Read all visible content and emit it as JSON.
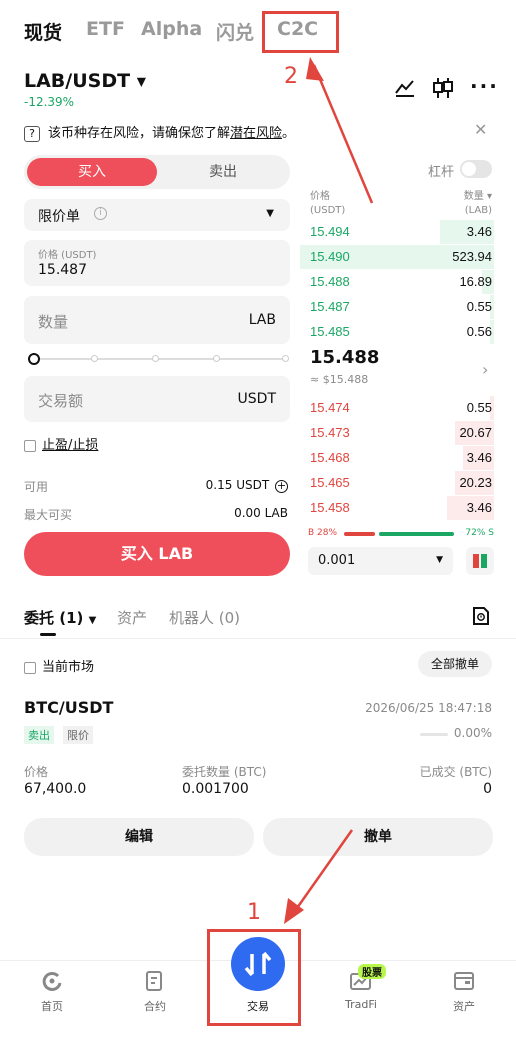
{
  "top_tabs": [
    "现货",
    "ETF",
    "Alpha",
    "闪兑",
    "C2C"
  ],
  "pair": {
    "symbol": "LAB/USDT",
    "change": "-12.39%"
  },
  "risk_notice": {
    "prefix": "该币种存在风险，请确保您了解",
    "link": "潜在风险",
    "suffix": "。"
  },
  "trade_form": {
    "buy_tab": "买入",
    "sell_tab": "卖出",
    "order_type": "限价单",
    "price_label": "价格 (USDT)",
    "price_value": "15.487",
    "qty_placeholder": "数量",
    "qty_unit": "LAB",
    "amount_placeholder": "交易额",
    "amount_unit": "USDT",
    "tpsl_label": "止盈/止损",
    "available_label": "可用",
    "available_value": "0.15 USDT",
    "max_buy_label": "最大可买",
    "max_buy_value": "0.00 LAB",
    "submit_label": "买入 LAB"
  },
  "orderbook": {
    "leverage_label": "杠杆",
    "price_header": "价格\n(USDT)",
    "qty_header": "数量 ▾\n(LAB)",
    "asks": [
      {
        "price": "15.494",
        "qty": "3.46",
        "depth": 0.28
      },
      {
        "price": "15.490",
        "qty": "523.94",
        "depth": 1.0
      },
      {
        "price": "15.488",
        "qty": "16.89",
        "depth": 0.06
      },
      {
        "price": "15.487",
        "qty": "0.55",
        "depth": 0.02
      },
      {
        "price": "15.485",
        "qty": "0.56",
        "depth": 0.02
      }
    ],
    "last_price": "15.488",
    "last_price_usd": "≈ $15.488",
    "bids": [
      {
        "price": "15.474",
        "qty": "0.55",
        "depth": 0.02
      },
      {
        "price": "15.473",
        "qty": "20.67",
        "depth": 0.2
      },
      {
        "price": "15.468",
        "qty": "3.46",
        "depth": 0.16
      },
      {
        "price": "15.465",
        "qty": "20.23",
        "depth": 0.2
      },
      {
        "price": "15.458",
        "qty": "3.46",
        "depth": 0.24
      }
    ],
    "ratio_b": "B 28%",
    "ratio_s": "72% S",
    "ratio_b_value": 0.28,
    "precision": "0.001"
  },
  "orders_section": {
    "tabs": [
      "委托 (1)",
      "资产",
      "机器人 (0)"
    ],
    "current_market_label": "当前市场",
    "cancel_all_label": "全部撤单",
    "order": {
      "symbol": "BTC/USDT",
      "side_tag": "卖出",
      "type_tag": "限价",
      "time": "2026/06/25 18:47:18",
      "progress": "0.00%",
      "price_label": "价格",
      "price_value": "67,400.0",
      "qty_label": "委托数量 (BTC)",
      "qty_value": "0.001700",
      "filled_label": "已成交 (BTC)",
      "filled_value": "0",
      "edit_label": "编辑",
      "cancel_label": "撤单"
    }
  },
  "bottom_nav": [
    {
      "label": "首页",
      "icon": "home-icon"
    },
    {
      "label": "合约",
      "icon": "futures-icon"
    },
    {
      "label": "交易",
      "icon": "trade-icon"
    },
    {
      "label": "TradFi",
      "icon": "tradfi-icon",
      "badge": "股票"
    },
    {
      "label": "资产",
      "icon": "wallet-icon"
    }
  ],
  "annotations": {
    "step1": "1",
    "step2": "2"
  },
  "colors": {
    "red": "#e0453e",
    "green": "#1aa764",
    "buy": "#ef4f5a",
    "nav_blue": "#2f6bf0"
  }
}
